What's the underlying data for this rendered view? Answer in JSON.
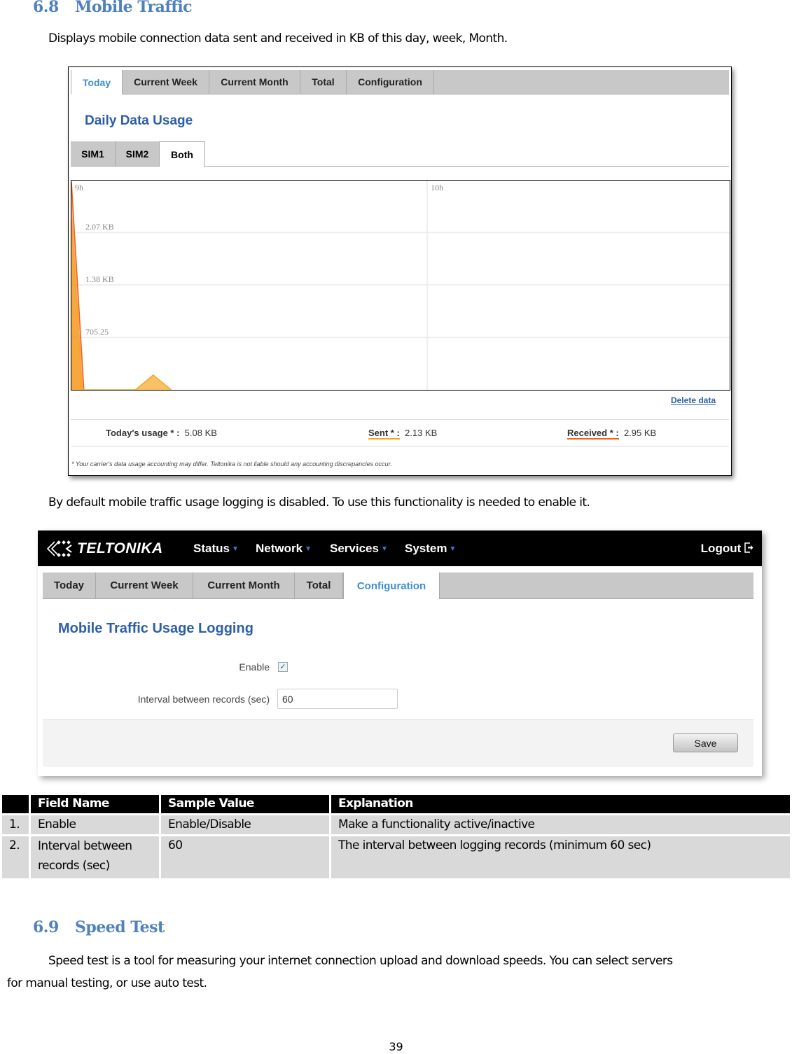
{
  "section_68": {
    "number": "6.8",
    "title": "Mobile Traffic",
    "intro": "Displays mobile connection data sent and received in KB of this day, week, Month."
  },
  "screenshot1": {
    "tabs": [
      {
        "label": "Today",
        "active": true
      },
      {
        "label": "Current Week",
        "active": false
      },
      {
        "label": "Current Month",
        "active": false
      },
      {
        "label": "Total",
        "active": false
      },
      {
        "label": "Configuration",
        "active": false
      }
    ],
    "title": "Daily Data Usage",
    "sim_tabs": [
      {
        "label": "SIM1",
        "active": false
      },
      {
        "label": "SIM2",
        "active": false
      },
      {
        "label": "Both",
        "active": true
      }
    ],
    "delete_link": "Delete data",
    "usage": {
      "total_label": "Today's usage * :",
      "total_value": "5.08 KB",
      "sent_label": "Sent * :",
      "sent_value": "2.13 KB",
      "received_label": "Received * :",
      "received_value": "2.95 KB"
    },
    "colors": {
      "sent": "#f5a623",
      "received": "#f06418"
    },
    "disclaimer": "* Your carrier's data usage accounting may differ. Teltonika is not liable should any accounting discrepancies occur."
  },
  "chart_data": {
    "type": "area",
    "title": "Daily Data Usage",
    "x_ticks": [
      "9h",
      "10h"
    ],
    "y_ticks": [
      "705.25",
      "1.38 KB",
      "2.07 KB"
    ],
    "y_tick_values_bytes": [
      705.25,
      1413,
      2120
    ],
    "ylim_bytes": [
      0,
      2820
    ],
    "xlim_hours": [
      9.0,
      10.85
    ],
    "series": [
      {
        "name": "Received",
        "color": "#f06418",
        "points": [
          [
            9.0,
            2800
          ],
          [
            9.035,
            0
          ]
        ]
      },
      {
        "name": "Sent",
        "color": "#f5a623",
        "points": [
          [
            9.0,
            2300
          ],
          [
            9.03,
            0
          ],
          [
            9.18,
            0
          ],
          [
            9.23,
            200
          ],
          [
            9.28,
            0
          ]
        ]
      }
    ],
    "grid": true
  },
  "mid_text": "By default mobile traffic usage logging is disabled.  To use this functionality is needed to enable it.",
  "screenshot2": {
    "brand": "TELTONIKA",
    "nav": [
      "Status",
      "Network",
      "Services",
      "System"
    ],
    "logout": "Logout",
    "tabs": [
      {
        "label": "Today",
        "active": false
      },
      {
        "label": "Current Week",
        "active": false
      },
      {
        "label": "Current Month",
        "active": false
      },
      {
        "label": "Total",
        "active": false
      },
      {
        "label": "Configuration",
        "active": true
      }
    ],
    "title": "Mobile Traffic Usage Logging",
    "enable_label": "Enable",
    "enable_checked": true,
    "interval_label": "Interval between records (sec)",
    "interval_value": "60",
    "save_label": "Save"
  },
  "table": {
    "headers": [
      "",
      "Field Name",
      "Sample Value",
      "Explanation"
    ],
    "rows": [
      [
        "1.",
        "Enable",
        "Enable/Disable",
        "Make a functionality active/inactive"
      ],
      [
        "2.",
        "Interval between records (sec)",
        "60",
        "The interval between logging records (minimum 60 sec)"
      ]
    ]
  },
  "section_69": {
    "number": "6.9",
    "title": "Speed Test",
    "line1": "Speed test is a tool for measuring your internet connection upload and download speeds. You can select servers",
    "line2": "for manual testing, or use auto test."
  },
  "page_number": "39"
}
